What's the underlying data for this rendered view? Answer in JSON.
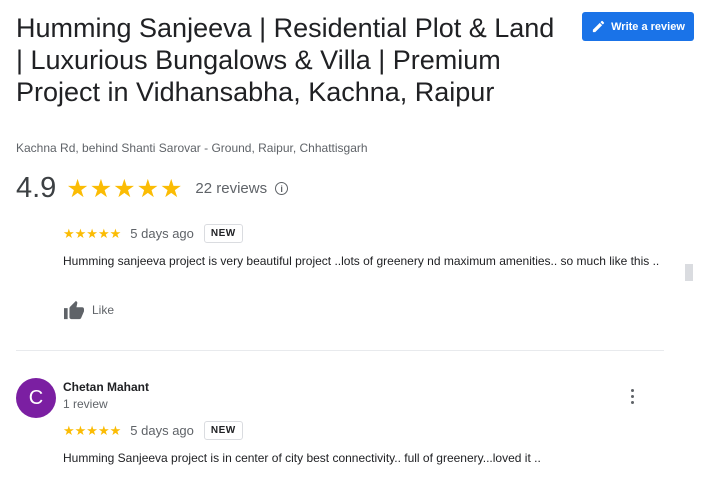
{
  "header": {
    "title": "Humming Sanjeeva | Residential Plot & Land | Luxurious Bungalows & Villa | Premium Project in Vidhansabha, Kachna, Raipur",
    "address": "Kachna Rd, behind Shanti Sarovar - Ground, Raipur, Chhattisgarh",
    "write_review_label": "Write a review",
    "write_review_icon": "pencil-icon"
  },
  "summary": {
    "rating": "4.9",
    "stars": "★★★★★",
    "reviews_label": "22 reviews",
    "info_icon": "i"
  },
  "reviews": [
    {
      "stars": "★★★★★",
      "rating": 5,
      "time_ago": "5 days ago",
      "badge": "NEW",
      "text": "Humming sanjeeva project is very beautiful project ..lots of greenery nd maximum amenities.. so much like this ..",
      "like_label": "Like"
    },
    {
      "avatar_letter": "C",
      "reviewer": "Chetan Mahant",
      "meta": "1 review",
      "stars": "★★★★★",
      "rating": 5,
      "time_ago": "5 days ago",
      "badge": "NEW",
      "text": "Humming Sanjeeva project is in center of city best connectivity.. full of greenery...loved it .."
    }
  ],
  "colors": {
    "accent": "#1a73e8",
    "star": "#fbbc04",
    "avatar": "#7b1fa2"
  }
}
